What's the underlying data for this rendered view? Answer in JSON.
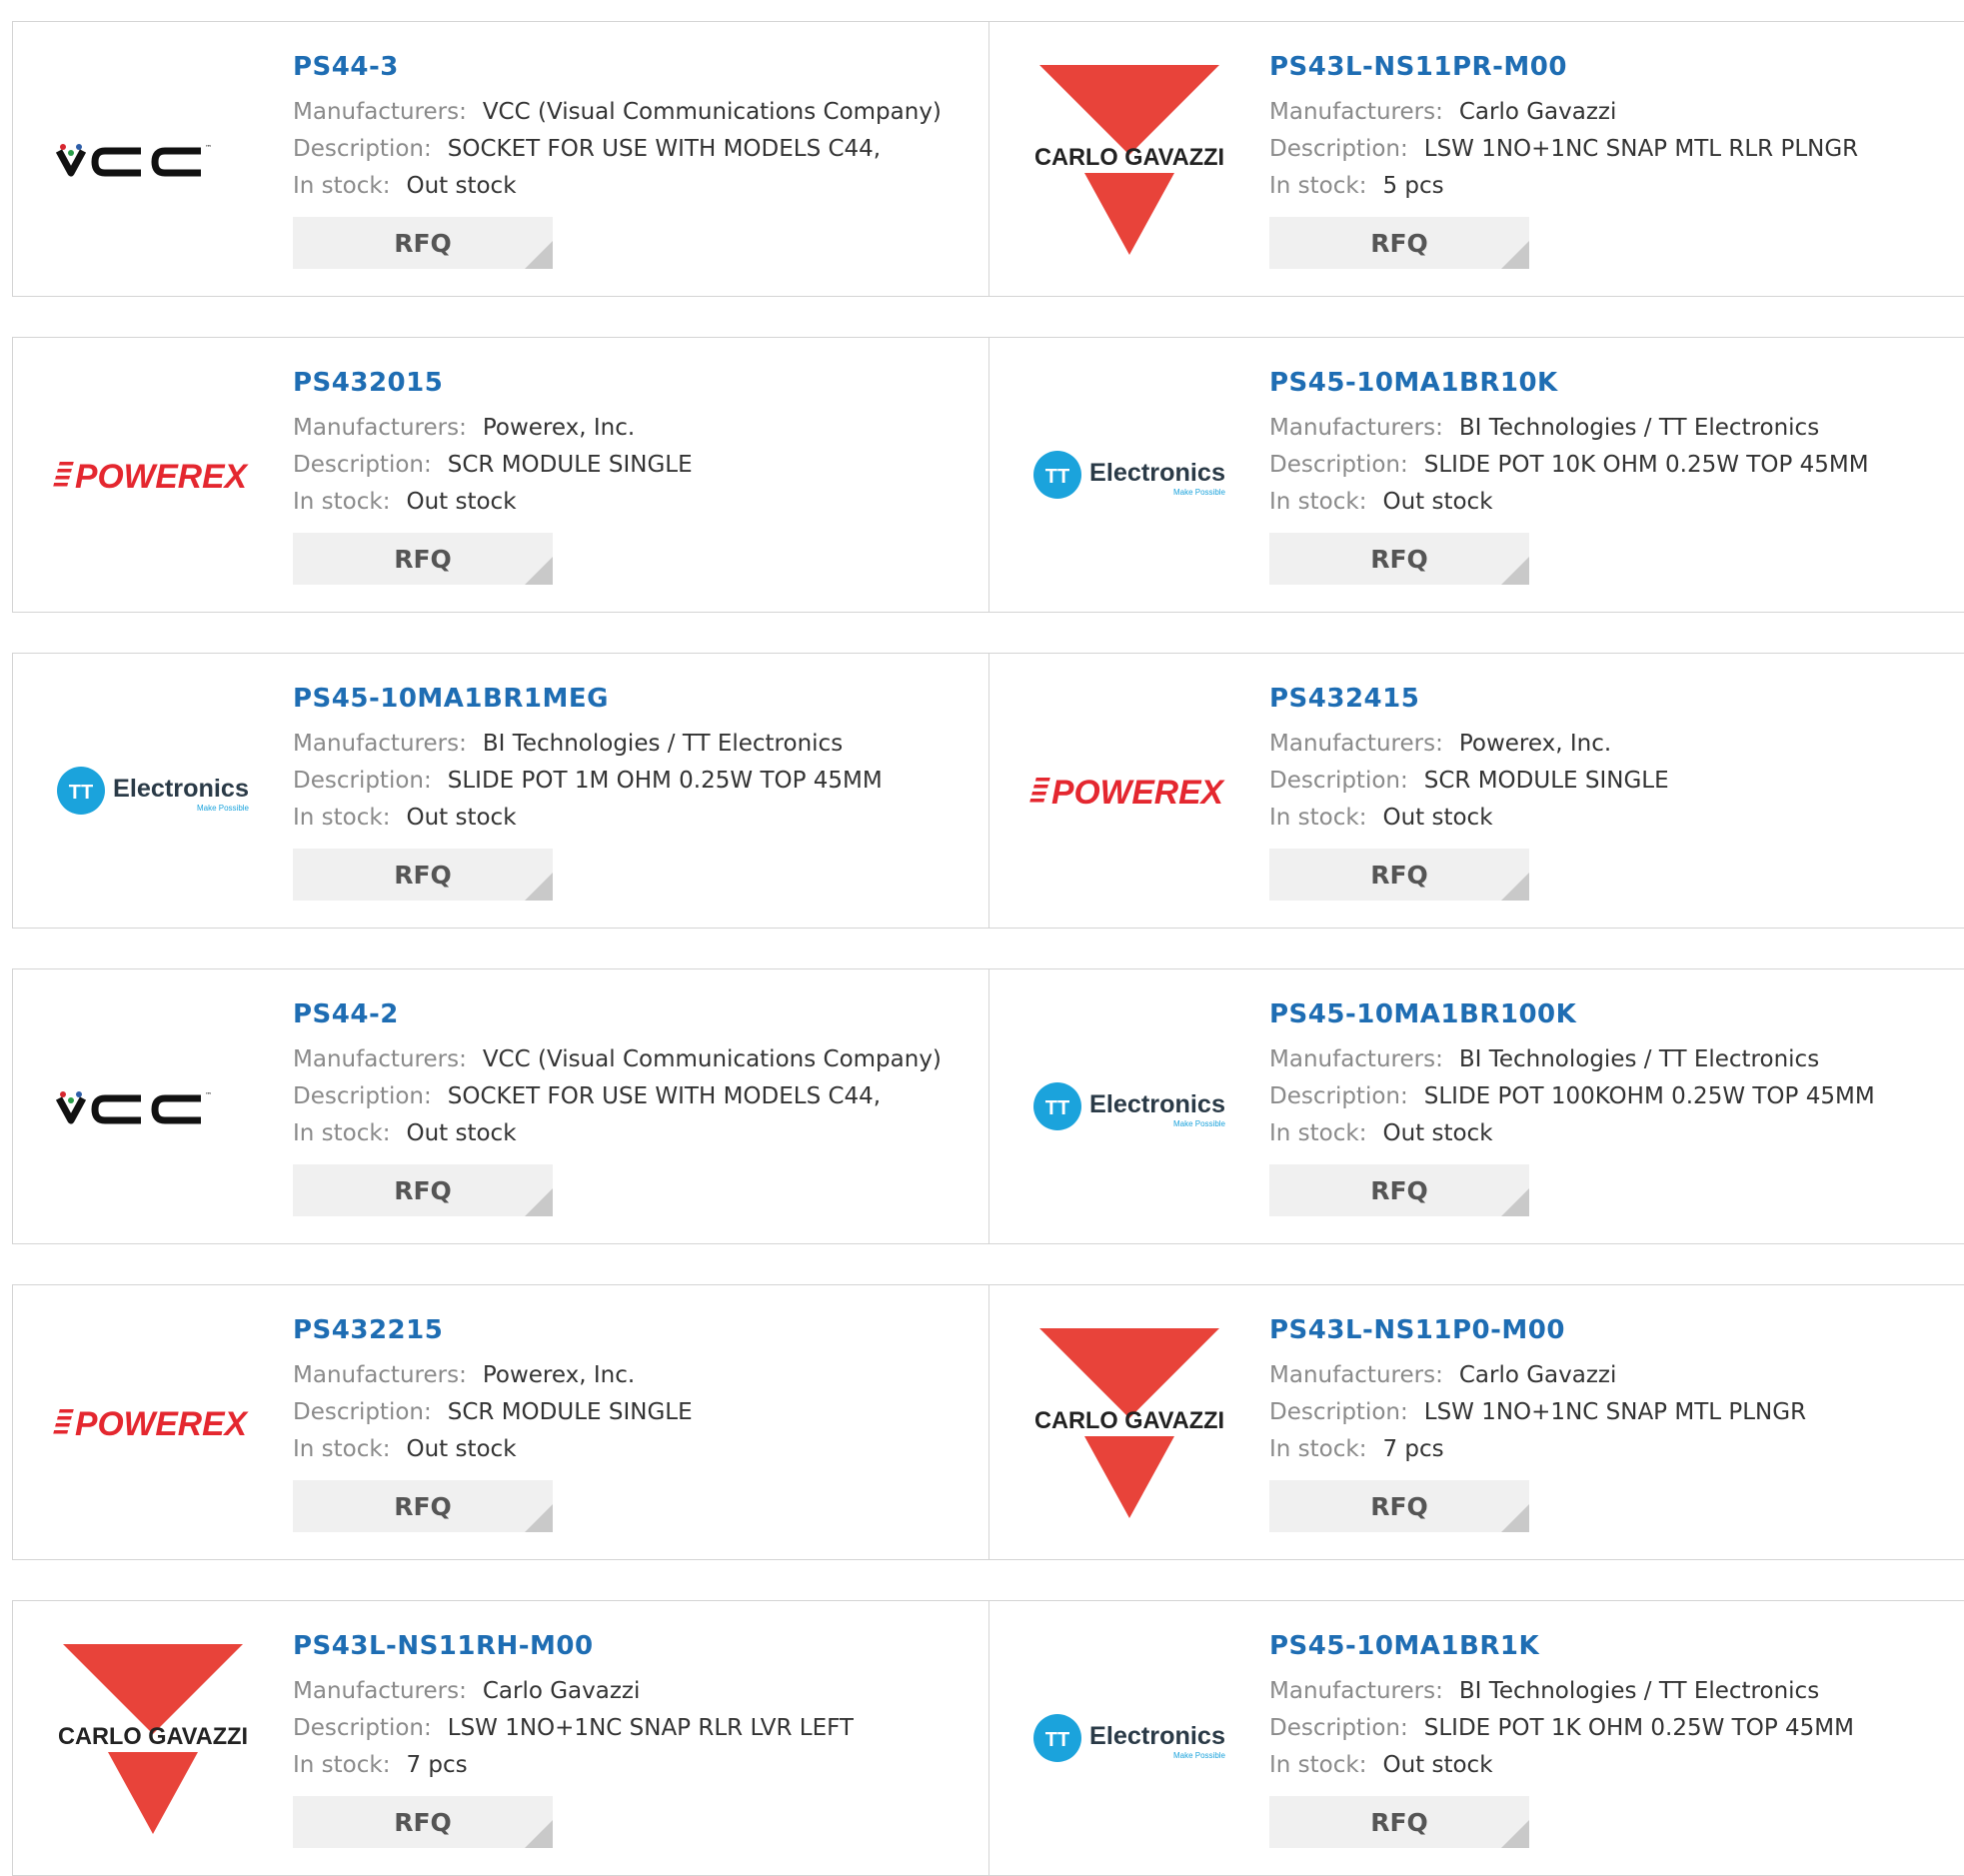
{
  "labels": {
    "manufacturers": "Manufacturers:",
    "description": "Description:",
    "stock": "In stock:",
    "rfq": "RFQ"
  },
  "logos": {
    "vcc": {
      "text": "VCC",
      "tm": "™",
      "colors": {
        "red": "#d7262f",
        "green": "#2a9d48",
        "blue": "#2d5ea8"
      }
    },
    "carlo": {
      "text": "CARLO GAVAZZI",
      "color": "#e8433a"
    },
    "powerex": {
      "text": "POWEREX",
      "color": "#e4272f"
    },
    "tt": {
      "text": "Electronics",
      "badge": "TT",
      "tagline": "Make Possible",
      "color": "#1ba3dc"
    }
  },
  "products": [
    {
      "part": "PS44-3",
      "logo": "vcc",
      "manufacturer": "VCC (Visual Communications Company)",
      "description": "SOCKET FOR USE WITH MODELS C44,",
      "stock": "Out stock"
    },
    {
      "part": "PS43L-NS11PR-M00",
      "logo": "carlo",
      "manufacturer": "Carlo Gavazzi",
      "description": "LSW 1NO+1NC SNAP MTL RLR PLNGR",
      "stock": "5 pcs"
    },
    {
      "part": "PS432015",
      "logo": "powerex",
      "manufacturer": "Powerex, Inc.",
      "description": "SCR MODULE SINGLE",
      "stock": "Out stock"
    },
    {
      "part": "PS45-10MA1BR10K",
      "logo": "tt",
      "manufacturer": "BI Technologies / TT Electronics",
      "description": "SLIDE POT 10K OHM 0.25W TOP 45MM",
      "stock": "Out stock"
    },
    {
      "part": "PS45-10MA1BR1MEG",
      "logo": "tt",
      "manufacturer": "BI Technologies / TT Electronics",
      "description": "SLIDE POT 1M OHM 0.25W TOP 45MM",
      "stock": "Out stock"
    },
    {
      "part": "PS432415",
      "logo": "powerex",
      "manufacturer": "Powerex, Inc.",
      "description": "SCR MODULE SINGLE",
      "stock": "Out stock"
    },
    {
      "part": "PS44-2",
      "logo": "vcc",
      "manufacturer": "VCC (Visual Communications Company)",
      "description": "SOCKET FOR USE WITH MODELS C44,",
      "stock": "Out stock"
    },
    {
      "part": "PS45-10MA1BR100K",
      "logo": "tt",
      "manufacturer": "BI Technologies / TT Electronics",
      "description": "SLIDE POT 100KOHM 0.25W TOP 45MM",
      "stock": "Out stock"
    },
    {
      "part": "PS432215",
      "logo": "powerex",
      "manufacturer": "Powerex, Inc.",
      "description": "SCR MODULE SINGLE",
      "stock": "Out stock"
    },
    {
      "part": "PS43L-NS11P0-M00",
      "logo": "carlo",
      "manufacturer": "Carlo Gavazzi",
      "description": "LSW 1NO+1NC SNAP MTL PLNGR",
      "stock": "7 pcs"
    },
    {
      "part": "PS43L-NS11RH-M00",
      "logo": "carlo",
      "manufacturer": "Carlo Gavazzi",
      "description": "LSW 1NO+1NC SNAP RLR LVR LEFT",
      "stock": "7 pcs"
    },
    {
      "part": "PS45-10MA1BR1K",
      "logo": "tt",
      "manufacturer": "BI Technologies / TT Electronics",
      "description": "SLIDE POT 1K OHM 0.25W TOP 45MM",
      "stock": "Out stock"
    }
  ]
}
